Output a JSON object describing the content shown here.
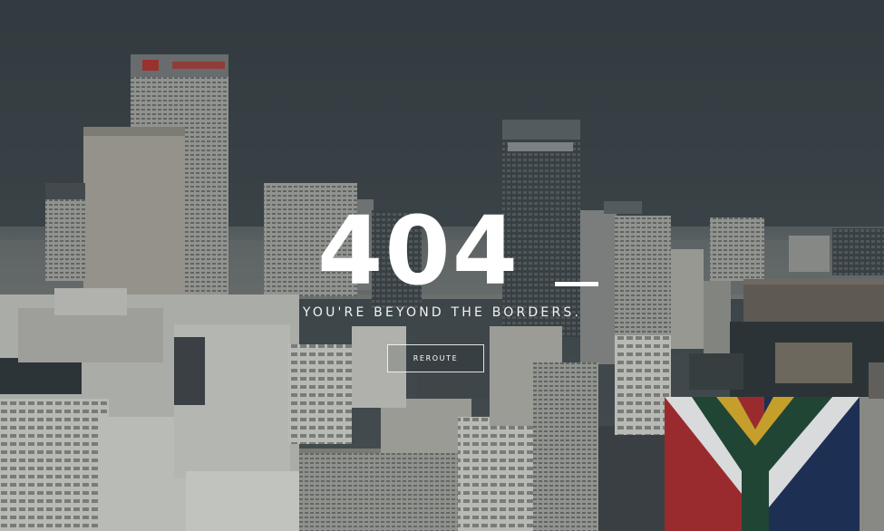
{
  "error": {
    "code": "404",
    "message": "YOU'RE BEYOND THE BORDERS.",
    "button_label": "REROUTE"
  },
  "background": {
    "description_icon": "city-skyline-image",
    "sky_color": "#3b4246",
    "building_color": "#cfcfca",
    "flag_colors": [
      "#b32a2e",
      "#1d2f5b",
      "#e8b82a",
      "#ffffff",
      "#1f4a35"
    ]
  }
}
